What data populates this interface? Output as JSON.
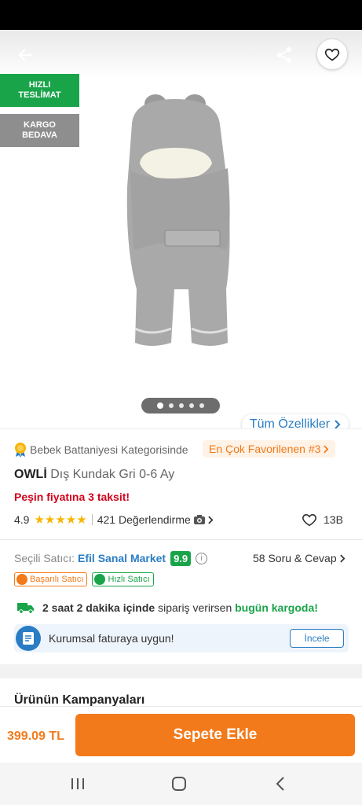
{
  "badges": {
    "fast_delivery": [
      "HIZLI",
      "TESLİMAT"
    ],
    "free_shipping": [
      "KARGO",
      "BEDAVA"
    ]
  },
  "gallery": {
    "all_features": "Tüm Özellikler"
  },
  "product": {
    "category_text": "Bebek Battaniyesi Kategorisinde",
    "favorite_rank": "En Çok Favorilenen #3",
    "brand": "OWLİ",
    "name": "Dış Kundak Gri 0-6 Ay",
    "installment": "Peşin fiyatına 3 taksit!",
    "rating": "4.9",
    "stars": "★★★★★",
    "reviews": "421 Değerlendirme",
    "likes": "13B"
  },
  "seller": {
    "label": "Seçili Satıcı:",
    "name": "Efil Sanal Market",
    "score": "9.9",
    "qa": "58 Soru & Cevap",
    "chips": [
      "Başarılı Satıcı",
      "Hızlı Satıcı"
    ]
  },
  "shipping": {
    "time": "2 saat 2 dakika içinde",
    "middle": " sipariş verirsen ",
    "highlight": "bugün kargoda!"
  },
  "corporate": {
    "text": "Kurumsal faturaya uygun!",
    "button": "İncele"
  },
  "campaigns": {
    "title": "Ürünün Kampanyaları"
  },
  "cart": {
    "price": "399.09 TL",
    "button": "Sepete Ekle"
  },
  "icons": [
    "back-arrow-icon",
    "share-icon",
    "heart-icon",
    "medal-icon",
    "camera-icon",
    "truck-icon",
    "invoice-icon"
  ],
  "colors": {
    "accent": "#f27a1a",
    "green": "#1aa44a",
    "blue": "#2a7dc4",
    "red": "#d0021b"
  }
}
